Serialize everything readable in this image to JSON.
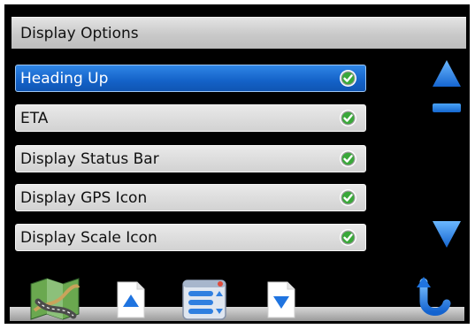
{
  "title": "Display Options",
  "items": [
    {
      "label": "Heading Up",
      "selected": true,
      "checked": true
    },
    {
      "label": "ETA",
      "selected": false,
      "checked": true
    },
    {
      "label": "Display Status Bar",
      "selected": false,
      "checked": true
    },
    {
      "label": "Display GPS Icon",
      "selected": false,
      "checked": true
    },
    {
      "label": "Display Scale Icon",
      "selected": false,
      "checked": true
    }
  ],
  "icons": {
    "check": "check-icon",
    "scroll_up": "triangle-up-icon",
    "scroll_down": "triangle-down-icon",
    "map": "map-icon",
    "page_up": "page-up-icon",
    "menu": "menu-list-icon",
    "page_down": "page-down-icon",
    "back": "back-arrow-icon"
  },
  "colors": {
    "accent": "#1462c8",
    "check_green": "#3aa83a"
  }
}
